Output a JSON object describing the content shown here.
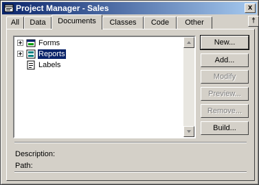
{
  "window": {
    "title": "Project Manager - Sales",
    "close_glyph": "x",
    "title_icon": "project-icon",
    "accent_color": "#0a246a"
  },
  "tabs": [
    {
      "label": "All"
    },
    {
      "label": "Data"
    },
    {
      "label": "Documents",
      "active": true
    },
    {
      "label": "Classes"
    },
    {
      "label": "Code"
    },
    {
      "label": "Other"
    }
  ],
  "tab_scroll_glyph": "†",
  "tree": {
    "items": [
      {
        "label": "Forms",
        "icon": "form-icon",
        "expandable": true,
        "selected": false
      },
      {
        "label": "Reports",
        "icon": "report-icon",
        "expandable": true,
        "selected": true
      },
      {
        "label": "Labels",
        "icon": "label-icon",
        "expandable": false,
        "selected": false
      }
    ]
  },
  "buttons": {
    "new": "New...",
    "add": "Add...",
    "modify": "Modify",
    "preview": "Preview...",
    "remove": "Remove...",
    "build": "Build..."
  },
  "info": {
    "description_label": "Description:",
    "path_label": "Path:"
  }
}
